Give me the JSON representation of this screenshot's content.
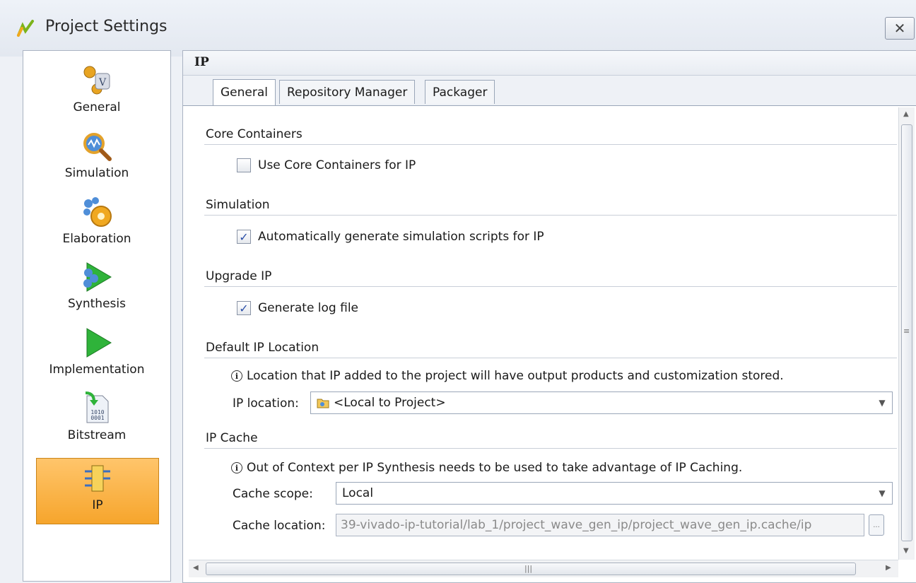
{
  "window": {
    "title": "Project Settings",
    "close_glyph": "✕"
  },
  "sidebar": {
    "items": [
      {
        "label": "General",
        "icon": "general-icon"
      },
      {
        "label": "Simulation",
        "icon": "simulation-icon"
      },
      {
        "label": "Elaboration",
        "icon": "elaboration-icon"
      },
      {
        "label": "Synthesis",
        "icon": "synthesis-icon"
      },
      {
        "label": "Implementation",
        "icon": "implementation-icon"
      },
      {
        "label": "Bitstream",
        "icon": "bitstream-icon"
      },
      {
        "label": "IP",
        "icon": "ip-icon",
        "selected": true
      }
    ]
  },
  "panel": {
    "title": "IP",
    "tabs": [
      {
        "label": "General",
        "active": true
      },
      {
        "label": "Repository Manager",
        "active": false
      },
      {
        "label": "Packager",
        "active": false
      }
    ]
  },
  "sections": {
    "core_containers": {
      "title": "Core Containers",
      "checkbox_label": "Use Core Containers for IP",
      "checked": false
    },
    "simulation": {
      "title": "Simulation",
      "checkbox_label": "Automatically generate simulation scripts for IP",
      "checked": true
    },
    "upgrade_ip": {
      "title": "Upgrade IP",
      "checkbox_label": "Generate log file",
      "checked": true
    },
    "default_ip_location": {
      "title": "Default IP Location",
      "info": "Location that IP added to the project will have output products and customization stored.",
      "field_label": "IP location:",
      "field_value": "<Local to Project>"
    },
    "ip_cache": {
      "title": "IP Cache",
      "info": "Out of Context per IP Synthesis needs to be used to take advantage of IP Caching.",
      "scope_label": "Cache scope:",
      "scope_value": "Local",
      "location_label": "Cache location:",
      "location_value": "39-vivado-ip-tutorial/lab_1/project_wave_gen_ip/project_wave_gen_ip.cache/ip",
      "browse_label": "..."
    }
  },
  "colors": {
    "selected_bg": "#f6a52c",
    "check_color": "#2b4fa8",
    "accent_green": "#2fb33a"
  }
}
